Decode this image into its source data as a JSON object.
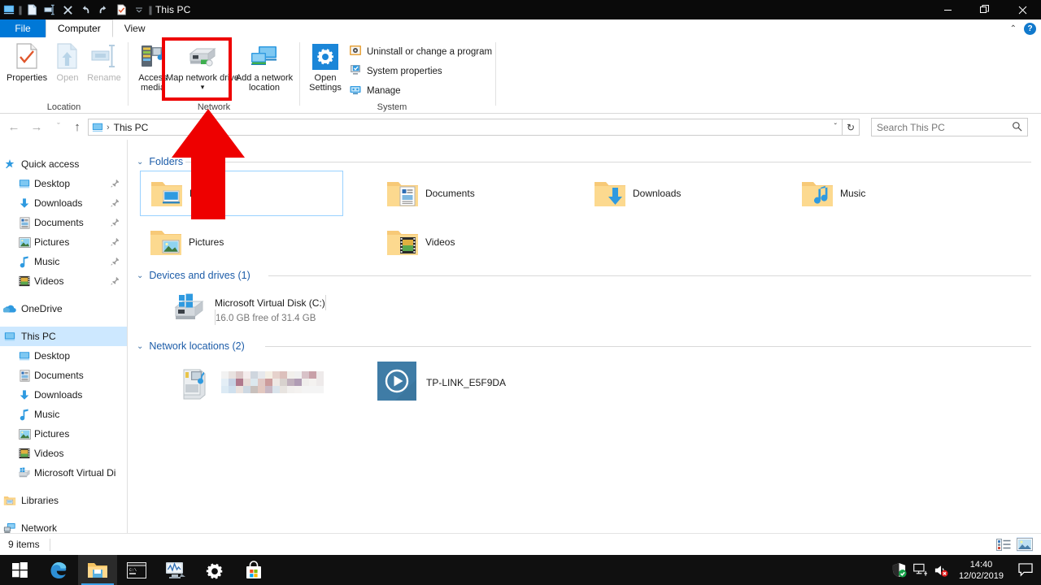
{
  "window": {
    "title": "This PC",
    "app_icon": "this-pc-monitor-icon",
    "quick_access_toolbar": [
      {
        "name": "properties-icon",
        "glyph": "❑"
      },
      {
        "name": "new-folder-icon",
        "glyph": "❐"
      },
      {
        "name": "delete-icon",
        "glyph": "✕"
      },
      {
        "name": "undo-icon",
        "glyph": "↶"
      },
      {
        "name": "redo-icon",
        "glyph": "↷"
      },
      {
        "name": "properties-check-icon",
        "glyph": "☑"
      },
      {
        "name": "customize-qat-chevron-icon",
        "glyph": "ˇ"
      }
    ],
    "controls": {
      "minimize": "—",
      "restore": "❐",
      "close": "✕"
    }
  },
  "ribbon": {
    "tabs": [
      {
        "label": "File",
        "active": false
      },
      {
        "label": "Computer",
        "active": true
      },
      {
        "label": "View",
        "active": false
      }
    ],
    "collapse_chevron": "⌃",
    "help_label": "?",
    "groups": [
      {
        "name": "Location",
        "label": "Location",
        "buttons": [
          {
            "label": "Properties",
            "icon": "properties-check-icon",
            "enabled": true
          },
          {
            "label": "Open",
            "icon": "open-arrow-icon",
            "enabled": false
          },
          {
            "label": "Rename",
            "icon": "rename-icon",
            "enabled": false
          }
        ]
      },
      {
        "name": "Network",
        "label": "Network",
        "buttons": [
          {
            "label": "Access media",
            "icon": "access-media-icon",
            "enabled": true,
            "has_dropdown": true
          },
          {
            "label": "Map network drive",
            "icon": "map-network-drive-icon",
            "enabled": true,
            "has_dropdown": true,
            "highlighted": true
          },
          {
            "label": "Add a network location",
            "icon": "add-network-location-icon",
            "enabled": true
          }
        ]
      },
      {
        "name": "System",
        "label": "System",
        "big_button": {
          "label": "Open Settings",
          "icon": "gear-icon"
        },
        "small_buttons": [
          {
            "label": "Uninstall or change a program",
            "icon": "uninstall-program-icon"
          },
          {
            "label": "System properties",
            "icon": "system-properties-icon"
          },
          {
            "label": "Manage",
            "icon": "manage-computer-icon"
          }
        ]
      }
    ]
  },
  "addressbar": {
    "back_icon": "←",
    "forward_icon": "→",
    "recent_icon": "ˇ",
    "up_icon": "↑",
    "crumb_icon": "this-pc-monitor-icon",
    "path": "This PC",
    "crumb_separator": "›",
    "dropdown_icon": "ˇ",
    "refresh_icon": "↻"
  },
  "search": {
    "placeholder": "Search This PC",
    "value": "",
    "icon": "search-magnifier-icon"
  },
  "sidebar": {
    "items": [
      {
        "label": "Quick access",
        "icon": "quick-access-star-icon",
        "level": 1,
        "pinned": false,
        "selected": false
      },
      {
        "label": "Desktop",
        "icon": "desktop-icon",
        "level": 2,
        "pinned": true,
        "selected": false
      },
      {
        "label": "Downloads",
        "icon": "downloads-arrow-icon",
        "level": 2,
        "pinned": true,
        "selected": false
      },
      {
        "label": "Documents",
        "icon": "documents-icon",
        "level": 2,
        "pinned": true,
        "selected": false
      },
      {
        "label": "Pictures",
        "icon": "pictures-icon",
        "level": 2,
        "pinned": true,
        "selected": false
      },
      {
        "label": "Music",
        "icon": "music-note-icon",
        "level": 2,
        "pinned": true,
        "selected": false
      },
      {
        "label": "Videos",
        "icon": "videos-film-icon",
        "level": 2,
        "pinned": true,
        "selected": false
      },
      {
        "label": "OneDrive",
        "icon": "onedrive-cloud-icon",
        "level": 1,
        "pinned": false,
        "selected": false,
        "gap_before": true
      },
      {
        "label": "This PC",
        "icon": "this-pc-monitor-icon",
        "level": 1,
        "pinned": false,
        "selected": true,
        "gap_before": true
      },
      {
        "label": "Desktop",
        "icon": "desktop-icon",
        "level": 2,
        "pinned": false,
        "selected": false
      },
      {
        "label": "Documents",
        "icon": "documents-icon",
        "level": 2,
        "pinned": false,
        "selected": false
      },
      {
        "label": "Downloads",
        "icon": "downloads-arrow-icon",
        "level": 2,
        "pinned": false,
        "selected": false
      },
      {
        "label": "Music",
        "icon": "music-note-icon",
        "level": 2,
        "pinned": false,
        "selected": false
      },
      {
        "label": "Pictures",
        "icon": "pictures-icon",
        "level": 2,
        "pinned": false,
        "selected": false
      },
      {
        "label": "Videos",
        "icon": "videos-film-icon",
        "level": 2,
        "pinned": false,
        "selected": false
      },
      {
        "label": "Microsoft Virtual Di",
        "icon": "hard-drive-icon",
        "level": 2,
        "pinned": false,
        "selected": false
      },
      {
        "label": "Libraries",
        "icon": "libraries-folder-icon",
        "level": 1,
        "pinned": false,
        "selected": false,
        "gap_before": true
      },
      {
        "label": "Network",
        "icon": "network-icon",
        "level": 1,
        "pinned": false,
        "selected": false,
        "gap_before": true
      }
    ]
  },
  "content": {
    "sections": [
      {
        "name": "folders",
        "title": "Folders",
        "chevron": "⌄",
        "items": [
          {
            "label": "Desktop",
            "icon": "folder-desktop-icon",
            "selected": true
          },
          {
            "label": "Documents",
            "icon": "folder-documents-icon",
            "selected": false
          },
          {
            "label": "Downloads",
            "icon": "folder-downloads-icon",
            "selected": false
          },
          {
            "label": "Music",
            "icon": "folder-music-icon",
            "selected": false
          },
          {
            "label": "Pictures",
            "icon": "folder-pictures-icon",
            "selected": false
          },
          {
            "label": "Videos",
            "icon": "folder-videos-icon",
            "selected": false
          }
        ]
      },
      {
        "name": "devices-and-drives",
        "title": "Devices and drives (1)",
        "chevron": "⌄",
        "drives": [
          {
            "label": "Microsoft Virtual Disk (C:)",
            "icon": "windows-drive-icon",
            "free_text": "16.0 GB free of 31.4 GB",
            "used_percent": 49,
            "bar_color": "#26a0da"
          }
        ]
      },
      {
        "name": "network-locations",
        "title": "Network locations (2)",
        "chevron": "⌄",
        "items": [
          {
            "label": "",
            "redacted": true,
            "icon": "media-server-icon"
          },
          {
            "label": "TP-LINK_E5F9DA",
            "redacted": false,
            "icon": "media-player-tile-icon"
          }
        ]
      }
    ]
  },
  "statusbar": {
    "item_count": "9 items",
    "views": [
      {
        "name": "details-view",
        "active": false
      },
      {
        "name": "large-icons-view",
        "active": true
      }
    ]
  },
  "taskbar": {
    "buttons": [
      {
        "name": "start-button",
        "icon": "windows-logo-icon",
        "active": false
      },
      {
        "name": "edge-button",
        "icon": "edge-browser-icon",
        "active": false
      },
      {
        "name": "file-explorer-button",
        "icon": "file-explorer-folder-icon",
        "active": true
      },
      {
        "name": "command-prompt-button",
        "icon": "command-prompt-icon",
        "active": false
      },
      {
        "name": "performance-monitor-button",
        "icon": "performance-monitor-icon",
        "active": false
      },
      {
        "name": "settings-button",
        "icon": "gear-icon",
        "active": false
      },
      {
        "name": "microsoft-store-button",
        "icon": "store-bag-icon",
        "active": false
      }
    ],
    "tray": [
      {
        "name": "windows-defender-icon"
      },
      {
        "name": "network-icon"
      },
      {
        "name": "volume-muted-icon"
      }
    ],
    "clock": {
      "time": "14:40",
      "date": "12/02/2019"
    },
    "action_center_icon": "action-center-icon"
  },
  "annotation": {
    "arrow_color": "#ee0000",
    "highlight_color": "#ee0000",
    "arrow_points_to": "Map network drive"
  }
}
